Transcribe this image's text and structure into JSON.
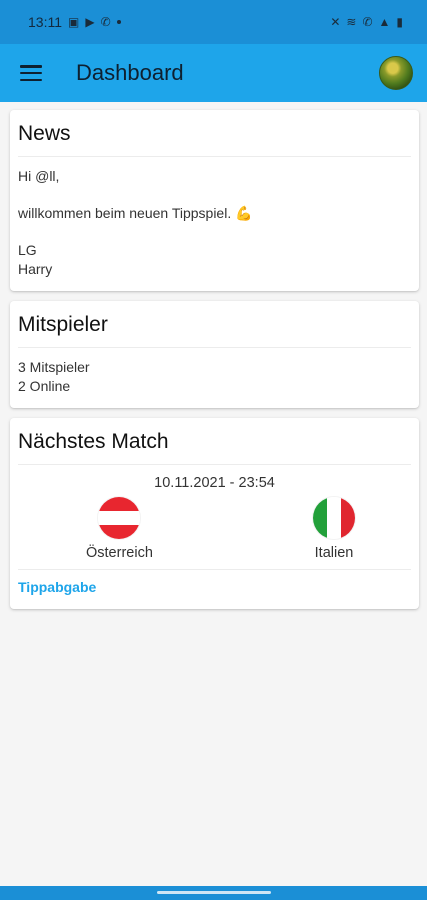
{
  "status_bar": {
    "time": "13:11"
  },
  "app_bar": {
    "title": "Dashboard"
  },
  "news": {
    "title": "News",
    "greeting": "Hi @ll,",
    "message": "willkommen beim neuen Tippspiel. 💪",
    "sign_off": "LG",
    "signature": "Harry"
  },
  "players": {
    "title": "Mitspieler",
    "count_text": "3 Mitspieler",
    "online_text": "2 Online"
  },
  "next_match": {
    "title": "Nächstes Match",
    "datetime": "10.11.2021 - 23:54",
    "home_team": "Österreich",
    "away_team": "Italien",
    "action_label": "Tippabgabe"
  },
  "colors": {
    "status_bar": "#1b8fd6",
    "app_bar": "#1ea5ea",
    "accent": "#1ea5ea",
    "austria_red": "#e8262f",
    "italy_green": "#22a03a",
    "italy_red": "#e0262f"
  },
  "icons": {
    "menu": "menu-icon",
    "avatar": "avatar-image"
  }
}
